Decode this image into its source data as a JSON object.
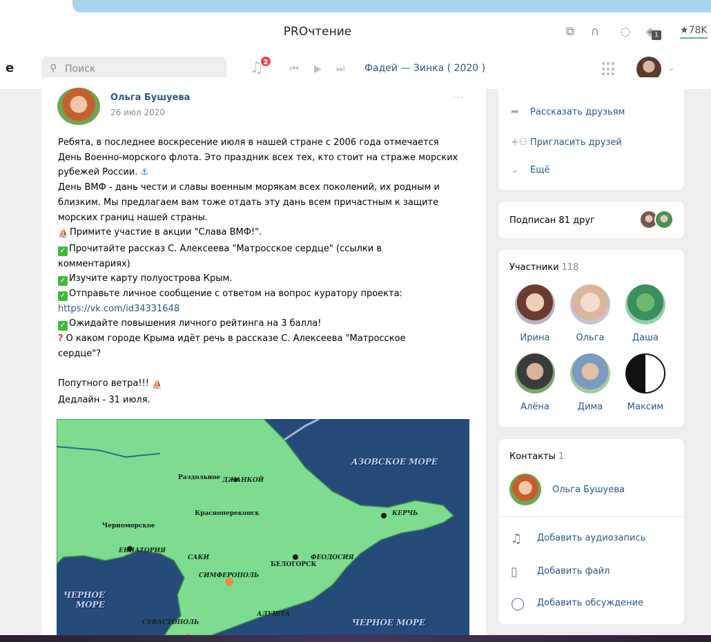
{
  "browser": {
    "title": "PROчтение",
    "star_count": "★78K",
    "tab_badge": "1",
    "icons": [
      "external-link-icon",
      "headphones-icon",
      "search-bubble-icon",
      "extension-icon",
      "star-icon"
    ]
  },
  "header": {
    "logo_fragment": "e",
    "search_placeholder": "Поиск",
    "notification_count": "2",
    "now_playing": "Фадей — Зинка ( 2020 )",
    "icons": [
      "search-icon",
      "bell-icon",
      "prev-track-icon",
      "play-icon",
      "next-track-icon",
      "apps-grid-icon",
      "chevron-down-icon"
    ]
  },
  "post": {
    "author": "Ольга Бушуева",
    "date": "26 июл 2020",
    "more": "···",
    "lines": {
      "l1": "Ребята, в последнее воскресение июля в нашей стране с 2006 года отмечается",
      "l2": "День Военно-морского флота. Это праздник всех тех, кто стоит на страже морских",
      "l3": "рубежей России.",
      "l4": "День ВМФ - дань чести и славы военным морякам всех поколений, их родным и",
      "l5": "близким. Мы предлагаем вам тоже отдать эту дань всем причастным к защите",
      "l6": "морских границ нашей страны.",
      "l7": "Примите участие в акции \"Слава ВМФ!\".",
      "l8": "Прочитайте рассказ С. Алексеева \"Матросское сердце\" (ссылки в",
      "l9": "комментариях)",
      "l10": "Изучите карту полуострова Крым.",
      "l11": "Отправьте личное сообщение с ответом на вопрос куратору проекта:",
      "l12": "https://vk.com/id34331648",
      "l13": "Ожидайте повышения личного рейтинга на 3 балла!",
      "l14": "О каком городе Крыма идёт речь в рассказе С. Алексеева \"Матросское",
      "l15": "сердце\"?",
      "l16": "Попутного ветра!!!",
      "l17": "Дедлайн - 31 июля."
    },
    "map_labels": {
      "azov": "АЗОВСКОЕ МОРЕ",
      "black1": "ЧЕРНОЕ",
      "black2": "МОРЕ",
      "black3": "ЧЕРНОЕ МОРЕ",
      "dzhankoy": "ДЖАНКОЙ",
      "kerch": "КЕРЧЬ",
      "evpatoriya": "ЕВПАТОРИЯ",
      "saki": "САКИ",
      "simferopol": "СИМФЕРОПОЛЬ",
      "feodosiya": "ФЕОДОСИЯ",
      "sevastopol": "СЕВАСТОПОЛЬ",
      "alushta": "АЛУШТА",
      "krasnoperekopsk": "Красноперекопск",
      "razdolnoe": "Раздольное",
      "chernomorskoe": "Черноморское",
      "belogorsk": "БЕЛОГОРСК"
    }
  },
  "sidebar": {
    "actions": {
      "tell_friends": "Рассказать друзьям",
      "invite_friends": "Пригласить друзей",
      "more": "Ещё"
    },
    "subscribed": "Подписан 81 друг",
    "members": {
      "title": "Участники",
      "count": "118",
      "people": [
        "Ирина",
        "Ольга",
        "Даша",
        "Алёна",
        "Дима",
        "Максим"
      ]
    },
    "contacts": {
      "title": "Контакты",
      "count": "1",
      "name": "Ольга Бушуева"
    },
    "add": {
      "audio": "Добавить аудиозапись",
      "file": "Добавить файл",
      "discussion": "Добавить обсуждение"
    }
  }
}
